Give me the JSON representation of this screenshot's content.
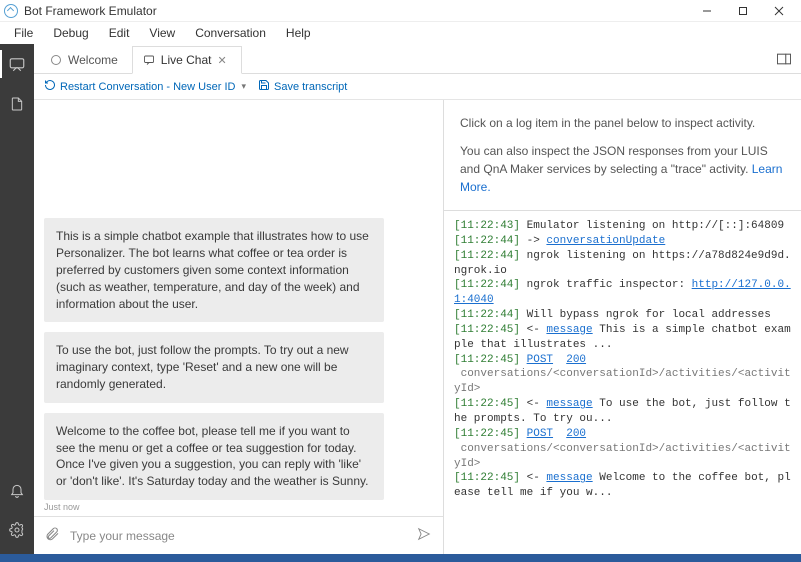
{
  "window": {
    "title": "Bot Framework Emulator"
  },
  "menu": {
    "items": [
      "File",
      "Debug",
      "Edit",
      "View",
      "Conversation",
      "Help"
    ]
  },
  "tabs": {
    "items": [
      {
        "label": "Welcome",
        "active": false,
        "closeable": false
      },
      {
        "label": "Live Chat",
        "active": true,
        "closeable": true
      }
    ]
  },
  "toolbar": {
    "restart_label": "Restart Conversation - New User ID",
    "save_label": "Save transcript"
  },
  "chat": {
    "messages": [
      "This is a simple chatbot example that illustrates how to use Personalizer. The bot learns what coffee or tea order is preferred by customers given some context information (such as weather, temperature, and day of the week) and information about the user.",
      "To use the bot, just follow the prompts. To try out a new imaginary context, type 'Reset' and a new one will be randomly generated.",
      "Welcome to the coffee bot, please tell me if you want to see the menu or get a coffee or tea suggestion for today. Once I've given you a suggestion, you can reply with 'like' or 'don't like'. It's Saturday today and the weather is Sunny."
    ],
    "timestamp": "Just now",
    "input_placeholder": "Type your message"
  },
  "inspector": {
    "line1": "Click on a log item in the panel below to inspect activity.",
    "line2_pre": "You can also inspect the JSON responses from your LUIS and QnA Maker services by selecting a \"trace\" activity. ",
    "line2_link": "Learn More."
  },
  "log": {
    "lines": [
      {
        "ts": "[11:22:43]",
        "parts": [
          {
            "t": "plain",
            "v": " Emulator listening on http://[::]:64809"
          }
        ]
      },
      {
        "ts": "[11:22:44]",
        "parts": [
          {
            "t": "arrow",
            "v": " -> "
          },
          {
            "t": "link",
            "v": "conversationUpdate"
          }
        ]
      },
      {
        "ts": "[11:22:44]",
        "parts": [
          {
            "t": "plain",
            "v": " ngrok listening on https://a78d824e9d9d.ngrok.io"
          }
        ]
      },
      {
        "ts": "[11:22:44]",
        "parts": [
          {
            "t": "plain",
            "v": " ngrok traffic inspector: "
          },
          {
            "t": "link",
            "v": "http://127.0.0.1:4040"
          }
        ]
      },
      {
        "ts": "[11:22:44]",
        "parts": [
          {
            "t": "plain",
            "v": " Will bypass ngrok for local addresses"
          }
        ]
      },
      {
        "ts": "[11:22:45]",
        "parts": [
          {
            "t": "arrow",
            "v": " <- "
          },
          {
            "t": "link",
            "v": "message"
          },
          {
            "t": "plain",
            "v": " This is a simple chatbot example that illustrates ..."
          }
        ]
      },
      {
        "ts": "[11:22:45]",
        "parts": [
          {
            "t": "plain",
            "v": " "
          },
          {
            "t": "link",
            "v": "POST"
          },
          {
            "t": "plain",
            "v": "  "
          },
          {
            "t": "status",
            "v": "200"
          }
        ]
      },
      {
        "sub": " conversations/<conversationId>/activities/<activityId>"
      },
      {
        "ts": "[11:22:45]",
        "parts": [
          {
            "t": "arrow",
            "v": " <- "
          },
          {
            "t": "link",
            "v": "message"
          },
          {
            "t": "plain",
            "v": " To use the bot, just follow the prompts. To try ou..."
          }
        ]
      },
      {
        "ts": "[11:22:45]",
        "parts": [
          {
            "t": "plain",
            "v": " "
          },
          {
            "t": "link",
            "v": "POST"
          },
          {
            "t": "plain",
            "v": "  "
          },
          {
            "t": "status",
            "v": "200"
          }
        ]
      },
      {
        "sub": " conversations/<conversationId>/activities/<activityId>"
      },
      {
        "ts": "[11:22:45]",
        "parts": [
          {
            "t": "arrow",
            "v": " <- "
          },
          {
            "t": "link",
            "v": "message"
          },
          {
            "t": "plain",
            "v": " Welcome to the coffee bot, please tell me if you w..."
          }
        ]
      }
    ]
  }
}
